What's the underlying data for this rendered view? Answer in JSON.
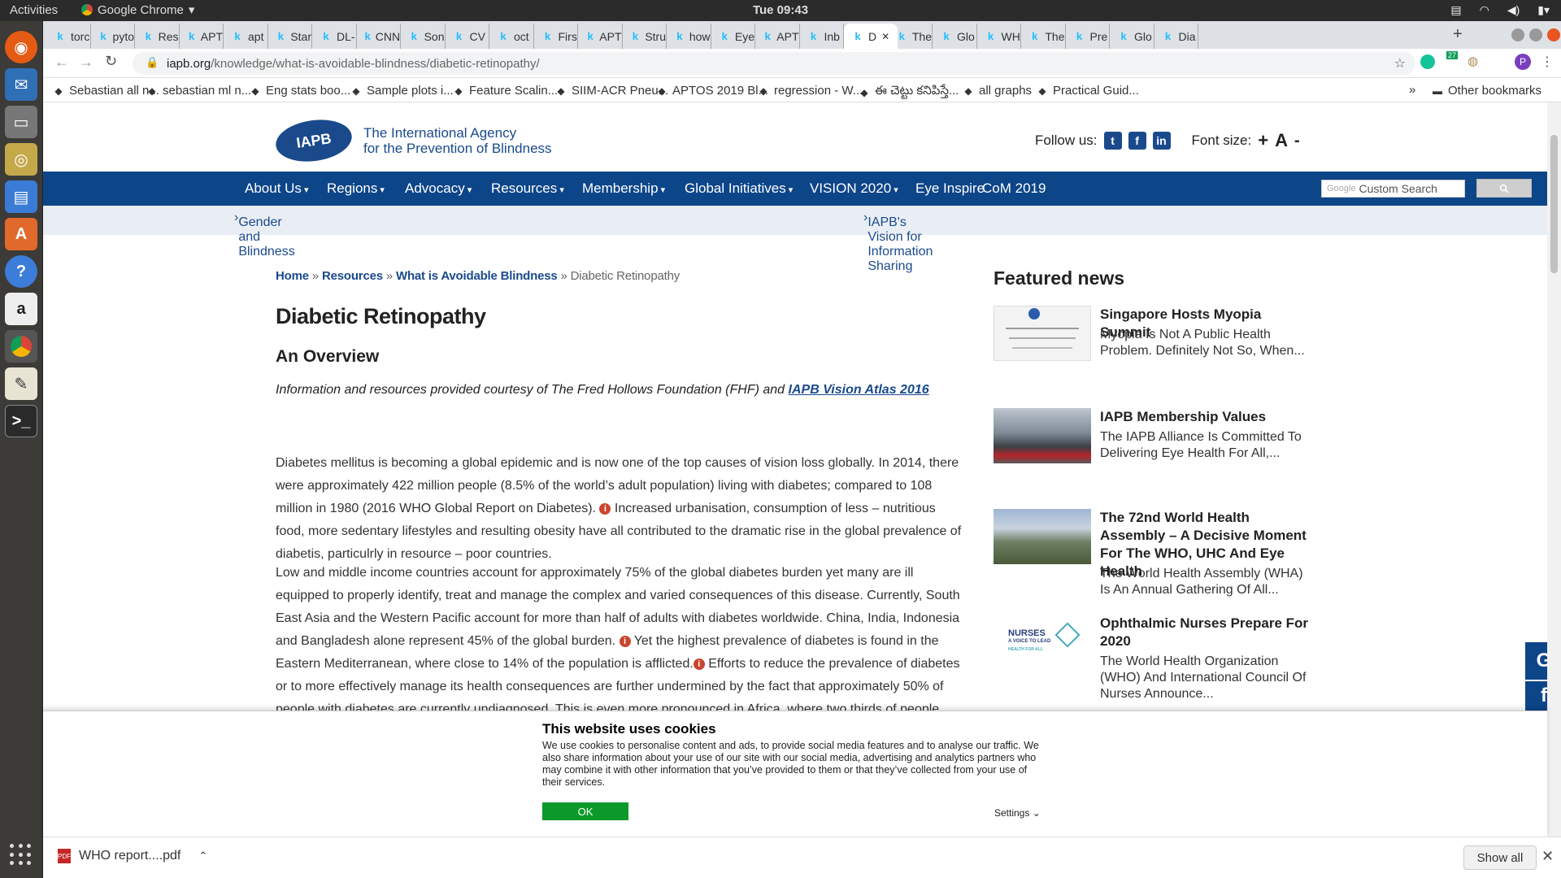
{
  "system": {
    "activities": "Activities",
    "app_name": "Google Chrome",
    "clock": "Tue 09:43",
    "tray_badge": "27"
  },
  "tabs": [
    {
      "label": "torc"
    },
    {
      "label": "pyto"
    },
    {
      "label": "Res"
    },
    {
      "label": "APT"
    },
    {
      "label": "apt"
    },
    {
      "label": "Star"
    },
    {
      "label": "DL-"
    },
    {
      "label": "CNN"
    },
    {
      "label": "Son"
    },
    {
      "label": "CV"
    },
    {
      "label": "oct"
    },
    {
      "label": "Firs"
    },
    {
      "label": "APT"
    },
    {
      "label": "Stru"
    },
    {
      "label": "how"
    },
    {
      "label": "Eye"
    },
    {
      "label": "APT"
    },
    {
      "label": "Inb"
    },
    {
      "label": "D"
    },
    {
      "label": "The"
    },
    {
      "label": "Glo"
    },
    {
      "label": "WH"
    },
    {
      "label": "The"
    },
    {
      "label": "Pre"
    },
    {
      "label": "Glo"
    },
    {
      "label": "Dia"
    }
  ],
  "omnibox": {
    "domain": "iapb.org",
    "path": "/knowledge/what-is-avoidable-blindness/diabetic-retinopathy/"
  },
  "bookmarks": [
    {
      "label": "Sebastian all n..."
    },
    {
      "label": "sebastian ml n..."
    },
    {
      "label": "Eng stats boo..."
    },
    {
      "label": "Sample plots i..."
    },
    {
      "label": "Feature Scalin..."
    },
    {
      "label": "SIIM-ACR Pneu..."
    },
    {
      "label": "APTOS 2019 Bl..."
    },
    {
      "label": "regression - W..."
    },
    {
      "label": "ఈ చెట్టు కనిపిస్తే..."
    },
    {
      "label": "all graphs"
    },
    {
      "label": "Practical Guid..."
    }
  ],
  "bookmarks_more": "»",
  "other_bookmarks": "Other bookmarks",
  "site": {
    "logo_mark": "IAPB",
    "logo_line1": "The International Agency",
    "logo_line2": "for the Prevention of Blindness",
    "follow_us": "Follow us:",
    "font_size": "Font size:",
    "font_plus": "+",
    "font_a": "A",
    "font_minus": "-",
    "nav": [
      "About Us",
      "Regions",
      "Advocacy",
      "Resources",
      "Membership",
      "Global Initiatives",
      "VISION 2020",
      "Eye Inspire",
      "CoM 2019"
    ],
    "search_brand": "Google",
    "search_placeholder": "Custom Search",
    "sub_links": [
      "Gender and Blindness",
      "IAPB's Vision for Information Sharing"
    ]
  },
  "article": {
    "breadcrumb": [
      "Home",
      "Resources",
      "What is Avoidable Blindness",
      "Diabetic Retinopathy"
    ],
    "breadcrumb_sep": "»",
    "title": "Diabetic Retinopathy",
    "subtitle": "An Overview",
    "courtesy": "Information and resources provided courtesy of The Fred Hollows Foundation (FHF) and",
    "courtesy_link": "IAPB Vision Atlas 2016",
    "p1a": "Diabetes mellitus is becoming a global epidemic and is now one of the top causes of vision loss globally. In 2014, there were approximately 422 million people (8.5% of the world’s adult population) living with diabetes; compared to 108 million in 1980 (2016 WHO Global Report on Diabetes).",
    "p1b": "Increased urbanisation, consumption of less – nutritious food, more sedentary lifestyles and resulting obesity have all contributed to the dramatic rise in the global prevalence of diabetis, particulrly in resource – poor countries.",
    "p2a": "Low and middle income countries account for approximately 75% of the global diabetes burden yet many are ill equipped to properly identify, treat and manage the complex and varied consequences of this disease. Currently, South East Asia and the Western Pacific account for more than half of adults with diabetes worldwide. China, India, Indonesia and Bangladesh alone represent 45% of the global burden.",
    "p2b": "Yet the highest prevalence of diabetes is found in the Eastern Mediterranean, where close to 14% of the population is afflicted.",
    "p2c": "Efforts to reduce the prevalence of diabetes or to more effectively manage its health consequences are further undermined by the fact that approximately 50% of people with diabetes are currently undiagnosed. This is even more pronounced in Africa, where two thirds of people",
    "info_glyph": "i"
  },
  "sidebar": {
    "heading": "Featured news",
    "news": [
      {
        "title": "Singapore Hosts Myopia Summit",
        "body": "Myopia Is Not A Public Health Problem. Definitely Not So, When..."
      },
      {
        "title": "IAPB Membership Values",
        "body": "The IAPB Alliance Is Committed To Delivering Eye Health For All,..."
      },
      {
        "title": "The 72nd World Health Assembly – A Decisive Moment For The WHO, UHC And Eye Health",
        "body": "The World Health Assembly (WHA) Is An Annual Gathering Of All..."
      },
      {
        "title": "Ophthalmic Nurses Prepare For 2020",
        "body": "The World Health Organization (WHO) And International Council Of Nurses Announce..."
      }
    ],
    "nurses_logo": "NURSES",
    "nurses_tag": "A VOICE TO LEAD",
    "nurses_sub": "HEALTH FOR ALL"
  },
  "share": {
    "google": "G",
    "facebook": "f"
  },
  "cookie": {
    "heading": "This website uses cookies",
    "body": "We use cookies to personalise content and ads, to provide social media features and to analyse our traffic. We also share information about your use of our site with our social media, advertising and analytics partners who may combine it with other information that you’ve provided to them or that they’ve collected from your use of their services.",
    "ok": "OK",
    "settings": "Settings"
  },
  "downloads": {
    "file": "WHO report....pdf",
    "show_all": "Show all"
  },
  "colors": {
    "nav_blue": "#0d4589",
    "brand_blue": "#1a4a8c",
    "ok_green": "#0b9a29",
    "info_red": "#c9452e"
  }
}
